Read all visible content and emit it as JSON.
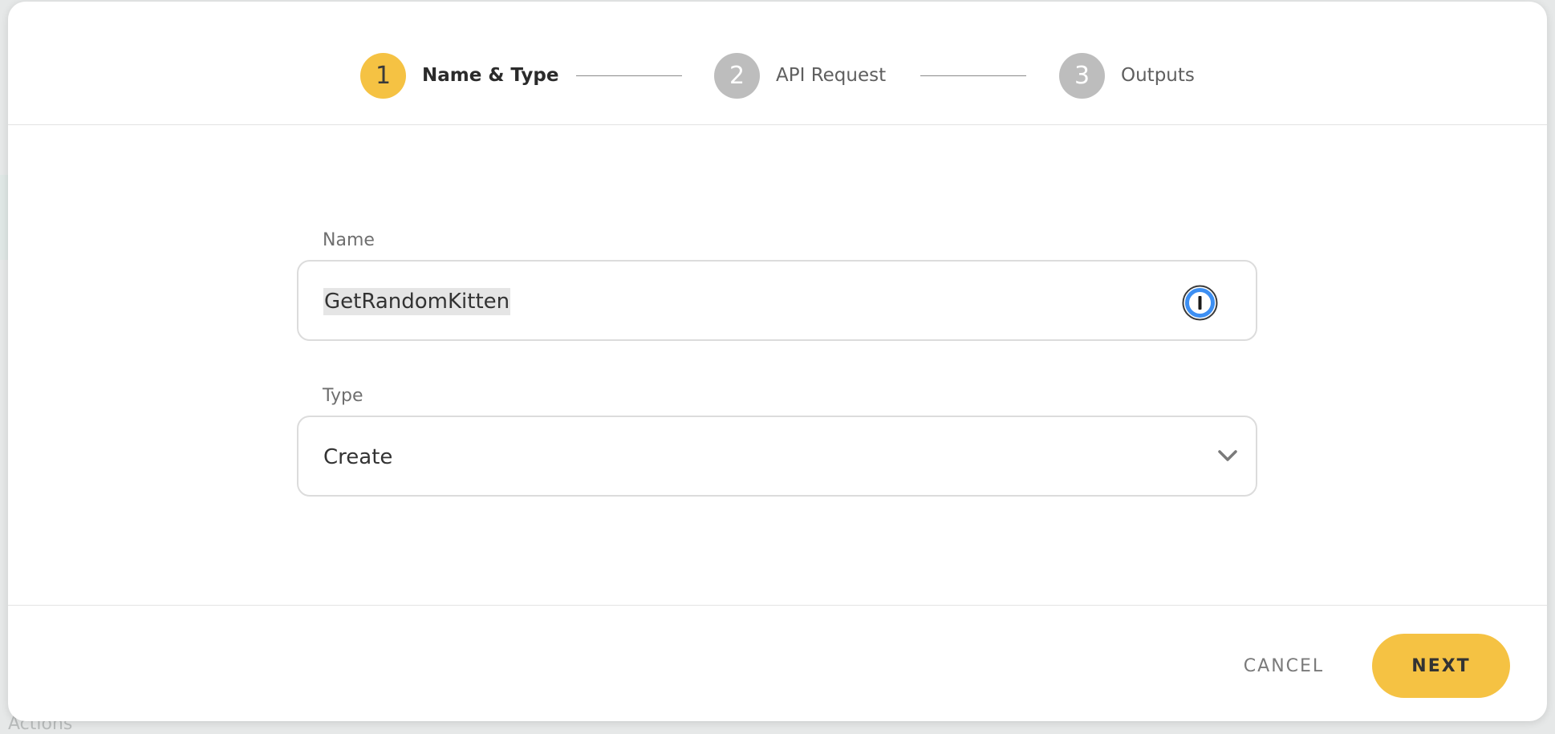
{
  "stepper": {
    "steps": [
      {
        "number": "1",
        "label": "Name & Type",
        "state": "active"
      },
      {
        "number": "2",
        "label": "API Request",
        "state": "inactive"
      },
      {
        "number": "3",
        "label": "Outputs",
        "state": "inactive"
      }
    ]
  },
  "form": {
    "name": {
      "label": "Name",
      "value": "GetRandomKitten",
      "autofill_icon": "password-manager-icon"
    },
    "type": {
      "label": "Type",
      "value": "Create",
      "icon": "chevron-down-icon"
    }
  },
  "footer": {
    "cancel_label": "CANCEL",
    "next_label": "NEXT"
  },
  "colors": {
    "accent": "#f5c243",
    "inactive_step": "#bdbdbd",
    "password_manager_blue": "#3d8ff2"
  },
  "background": {
    "partial_label": "Actions"
  }
}
